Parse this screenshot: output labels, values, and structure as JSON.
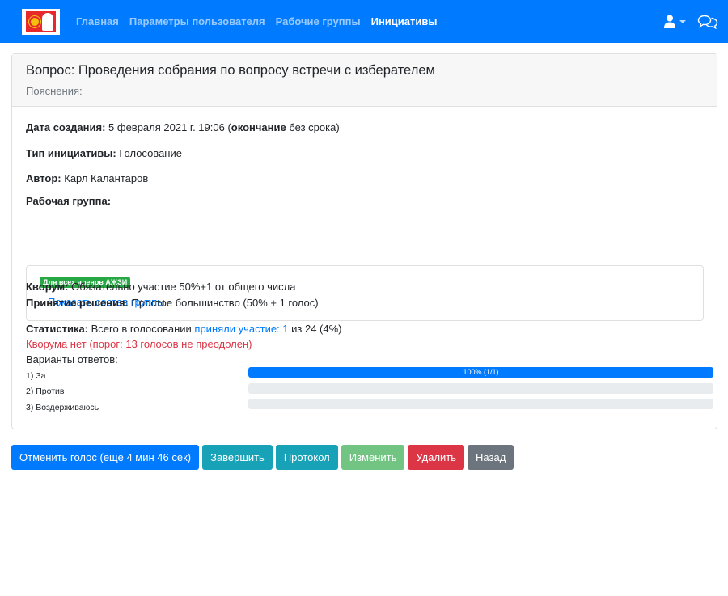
{
  "nav": {
    "links": [
      {
        "label": "Главная",
        "active": false
      },
      {
        "label": "Параметры пользователя",
        "active": false
      },
      {
        "label": "Рабочие группы",
        "active": false
      },
      {
        "label": "Инициативы",
        "active": true
      }
    ],
    "icons": [
      "user-icon",
      "chat-icon"
    ]
  },
  "card": {
    "title": "Вопрос: Проведения собрания по вопросу встречи с изберателем",
    "subtitle": "Пояснения:",
    "created_label": "Дата создания:",
    "created_value": "5 февраля 2021 г. 19:06",
    "end_label": "окончание",
    "end_value": "без срока",
    "type_label": "Тип инициативы:",
    "type_value": "Голосование",
    "author_label": "Автор:",
    "author_value": "Карл Калантаров",
    "group_label": "Рабочая группа:",
    "group_badge": "Для всех членов АЖЗИ",
    "group_show_link": "Показать состав группы",
    "quorum_label": "Кворум:",
    "quorum_value": "Обязательно участие 50%+1 от общего числа",
    "decision_label": "Принятие решения:",
    "decision_value": "Простое большинство (50% + 1 голос)",
    "stats_label": "Статистика:",
    "stats_text": "Всего в голосовании",
    "stats_link": "приняли участие: 1",
    "stats_suffix": "из 24 (4%)",
    "quorum_warning": "Кворума нет (порог: 13 голосов не преодолен)",
    "options_heading": "Варианты ответов:",
    "options": [
      {
        "label": "1) За",
        "percent": 100,
        "bar_text": "100% (1/1)"
      },
      {
        "label": "2) Против",
        "percent": 0,
        "bar_text": ""
      },
      {
        "label": "3) Воздерживаюсь",
        "percent": 0,
        "bar_text": ""
      }
    ]
  },
  "buttons": {
    "cancel_vote": "Отменить голос (еще 4 мин 46 сек)",
    "finish": "Завершить",
    "protocol": "Протокол",
    "edit": "Изменить",
    "delete": "Удалить",
    "back": "Назад"
  },
  "colors": {
    "primary": "#007bff",
    "info": "#17a2b8",
    "success": "#28a745",
    "danger": "#dc3545",
    "secondary": "#6c757d"
  }
}
